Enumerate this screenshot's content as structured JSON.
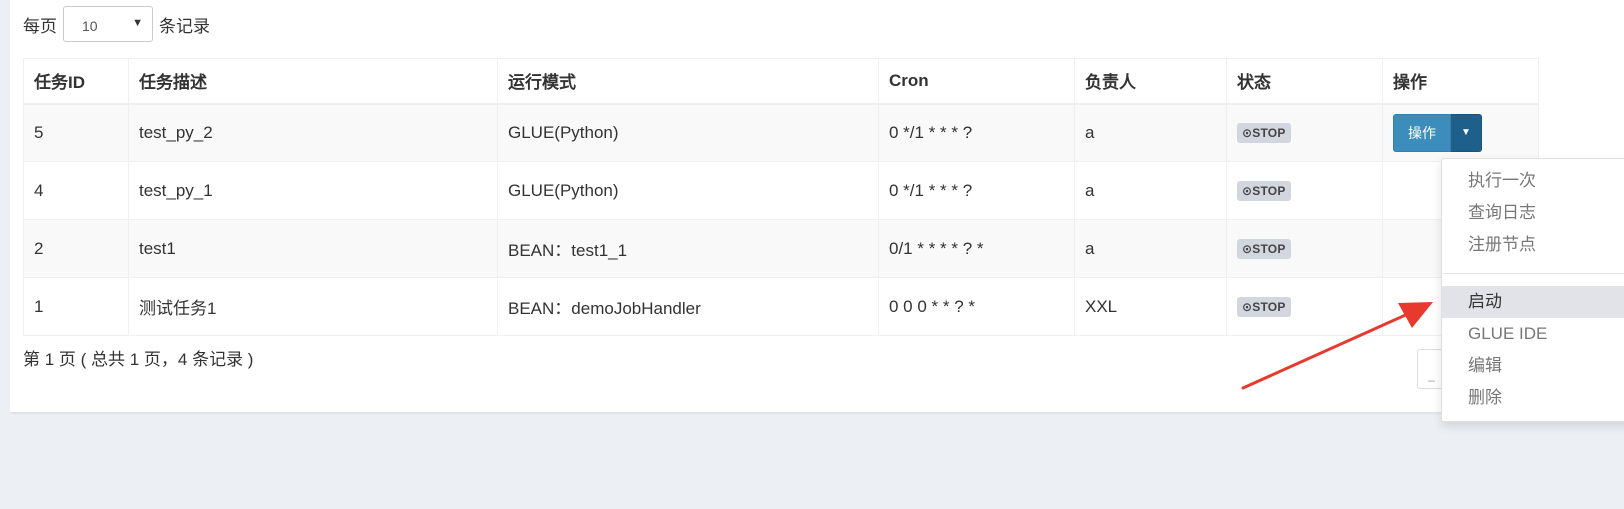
{
  "length_menu": {
    "prefix": "每页",
    "value": "10",
    "suffix": "条记录"
  },
  "table": {
    "headers": [
      "任务ID",
      "任务描述",
      "运行模式",
      "Cron",
      "负责人",
      "状态",
      "操作"
    ],
    "rows": [
      {
        "id": "5",
        "desc": "test_py_2",
        "mode": "GLUE(Python)",
        "cron": "0 */1 * * * ?",
        "owner": "a",
        "status": "STOP"
      },
      {
        "id": "4",
        "desc": "test_py_1",
        "mode": "GLUE(Python)",
        "cron": "0 */1 * * * ?",
        "owner": "a",
        "status": "STOP"
      },
      {
        "id": "2",
        "desc": "test1",
        "mode": "BEAN：test1_1",
        "cron": "0/1 * * * * ? *",
        "owner": "a",
        "status": "STOP"
      },
      {
        "id": "1",
        "desc": "测试任务1",
        "mode": "BEAN：demoJobHandler",
        "cron": "0 0 0 * * ? *",
        "owner": "XXL",
        "status": "STOP"
      }
    ],
    "action_label": "操作",
    "status_icon": "⊙"
  },
  "info": "第 1 页 ( 总共 1 页，4 条记录 )",
  "pager_stub": "_",
  "dropdown": {
    "items": [
      "执行一次",
      "查询日志",
      "注册节点",
      "启动",
      "GLUE IDE",
      "编辑",
      "删除"
    ],
    "highlighted": "启动"
  },
  "colors": {
    "primary": "#3c8dbc",
    "primary_dark": "#1f5f8b",
    "badge": "#d2d6de",
    "annotation_arrow": "#e8392f",
    "background": "#ecf0f5"
  },
  "icons": {
    "caret": "caret-down-icon",
    "status": "stop-circle-icon"
  }
}
